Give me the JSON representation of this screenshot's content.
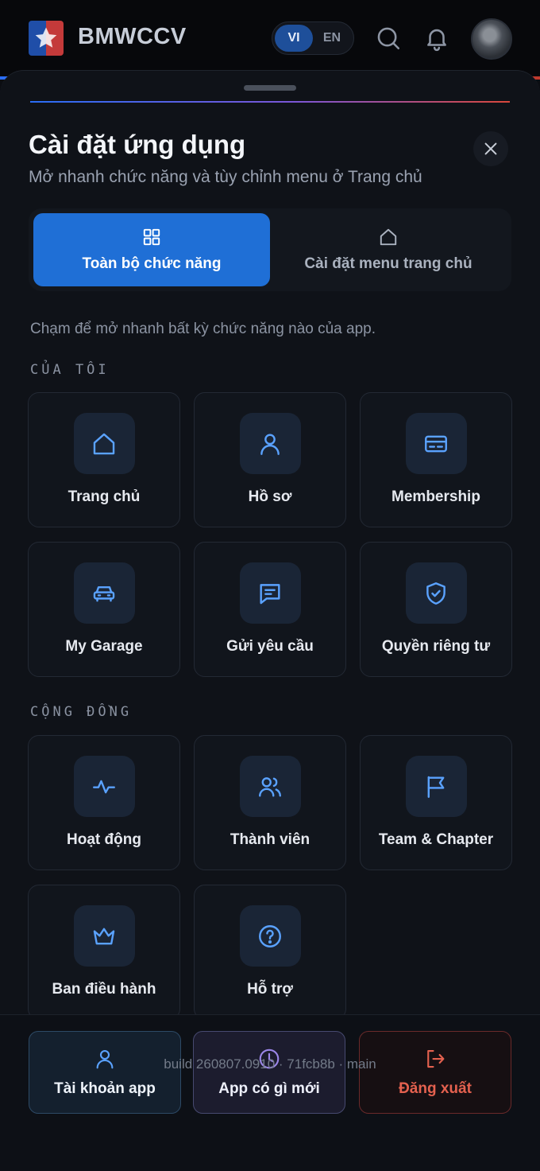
{
  "header": {
    "brand": "BMWCCV",
    "lang_options": [
      "VI",
      "EN"
    ],
    "lang_active": "VI",
    "icons": [
      "search-icon",
      "bell-icon"
    ]
  },
  "sheet": {
    "title": "Cài đặt ứng dụng",
    "subtitle": "Mở nhanh chức năng và tùy chỉnh menu ở Trang chủ",
    "tabs": [
      {
        "label": "Toàn bộ chức năng",
        "icon": "grid-icon",
        "active": true
      },
      {
        "label": "Cài đặt menu trang chủ",
        "icon": "home-icon",
        "active": false
      }
    ],
    "hint": "Chạm để mở nhanh bất kỳ chức năng nào của app.",
    "sections": [
      {
        "title": "CỦA TÔI",
        "items": [
          {
            "label": "Trang chủ",
            "icon": "home-icon"
          },
          {
            "label": "Hồ sơ",
            "icon": "user-icon"
          },
          {
            "label": "Membership",
            "icon": "card-icon"
          },
          {
            "label": "My Garage",
            "icon": "car-icon"
          },
          {
            "label": "Gửi yêu cầu",
            "icon": "message-icon"
          },
          {
            "label": "Quyền riêng tư",
            "icon": "shield-icon"
          }
        ]
      },
      {
        "title": "CỘNG ĐỒNG",
        "items": [
          {
            "label": "Hoạt động",
            "icon": "activity-icon"
          },
          {
            "label": "Thành viên",
            "icon": "users-icon"
          },
          {
            "label": "Team & Chapter",
            "icon": "flag-icon"
          },
          {
            "label": "Ban điều hành",
            "icon": "crown-icon"
          },
          {
            "label": "Hỗ trợ",
            "icon": "help-icon"
          }
        ]
      }
    ]
  },
  "footer": {
    "buttons": [
      {
        "label": "Tài khoản app",
        "icon": "user-icon"
      },
      {
        "label": "App có gì mới",
        "icon": "clock-icon"
      },
      {
        "label": "Đăng xuất",
        "icon": "logout-icon"
      }
    ],
    "build": "build 260807.0910 · 71fcb8b · main"
  },
  "colors": {
    "accent": "#1f6fd6",
    "icon_blue": "#5aa2ff",
    "icon_purple": "#9b86e8",
    "danger": "#e4614f"
  }
}
